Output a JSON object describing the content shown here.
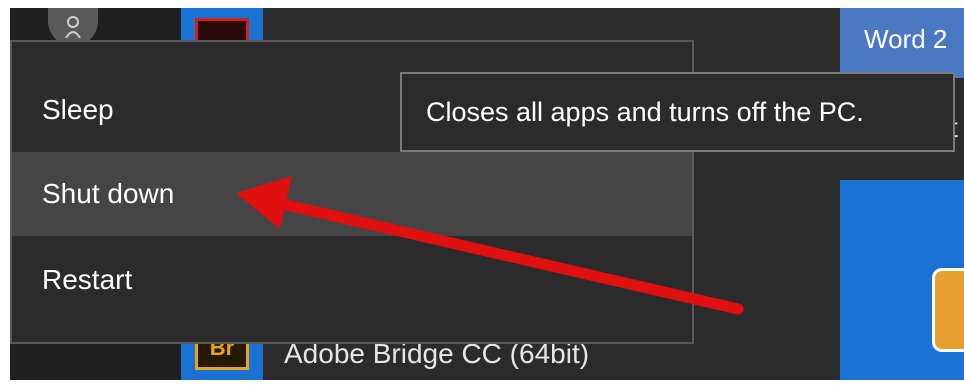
{
  "power_menu": {
    "items": [
      {
        "label": "Sleep"
      },
      {
        "label": "Shut down",
        "hovered": true
      },
      {
        "label": "Restart"
      }
    ]
  },
  "tooltip": {
    "text": "Closes all apps and turns off the PC."
  },
  "tiles": {
    "word_label": "Word 2",
    "bridge_label": "Adobe Bridge CC (64bit)",
    "bridge_icon_text": "Br",
    "peek_letter": "t"
  },
  "annotation": {
    "arrow_color": "#e01010",
    "points_to": "Shut down"
  },
  "colors": {
    "menu_bg": "#2b2b2b",
    "hover_bg": "#454545",
    "tile_blue": "#1a72d4",
    "word_blue": "#4a78c2"
  }
}
